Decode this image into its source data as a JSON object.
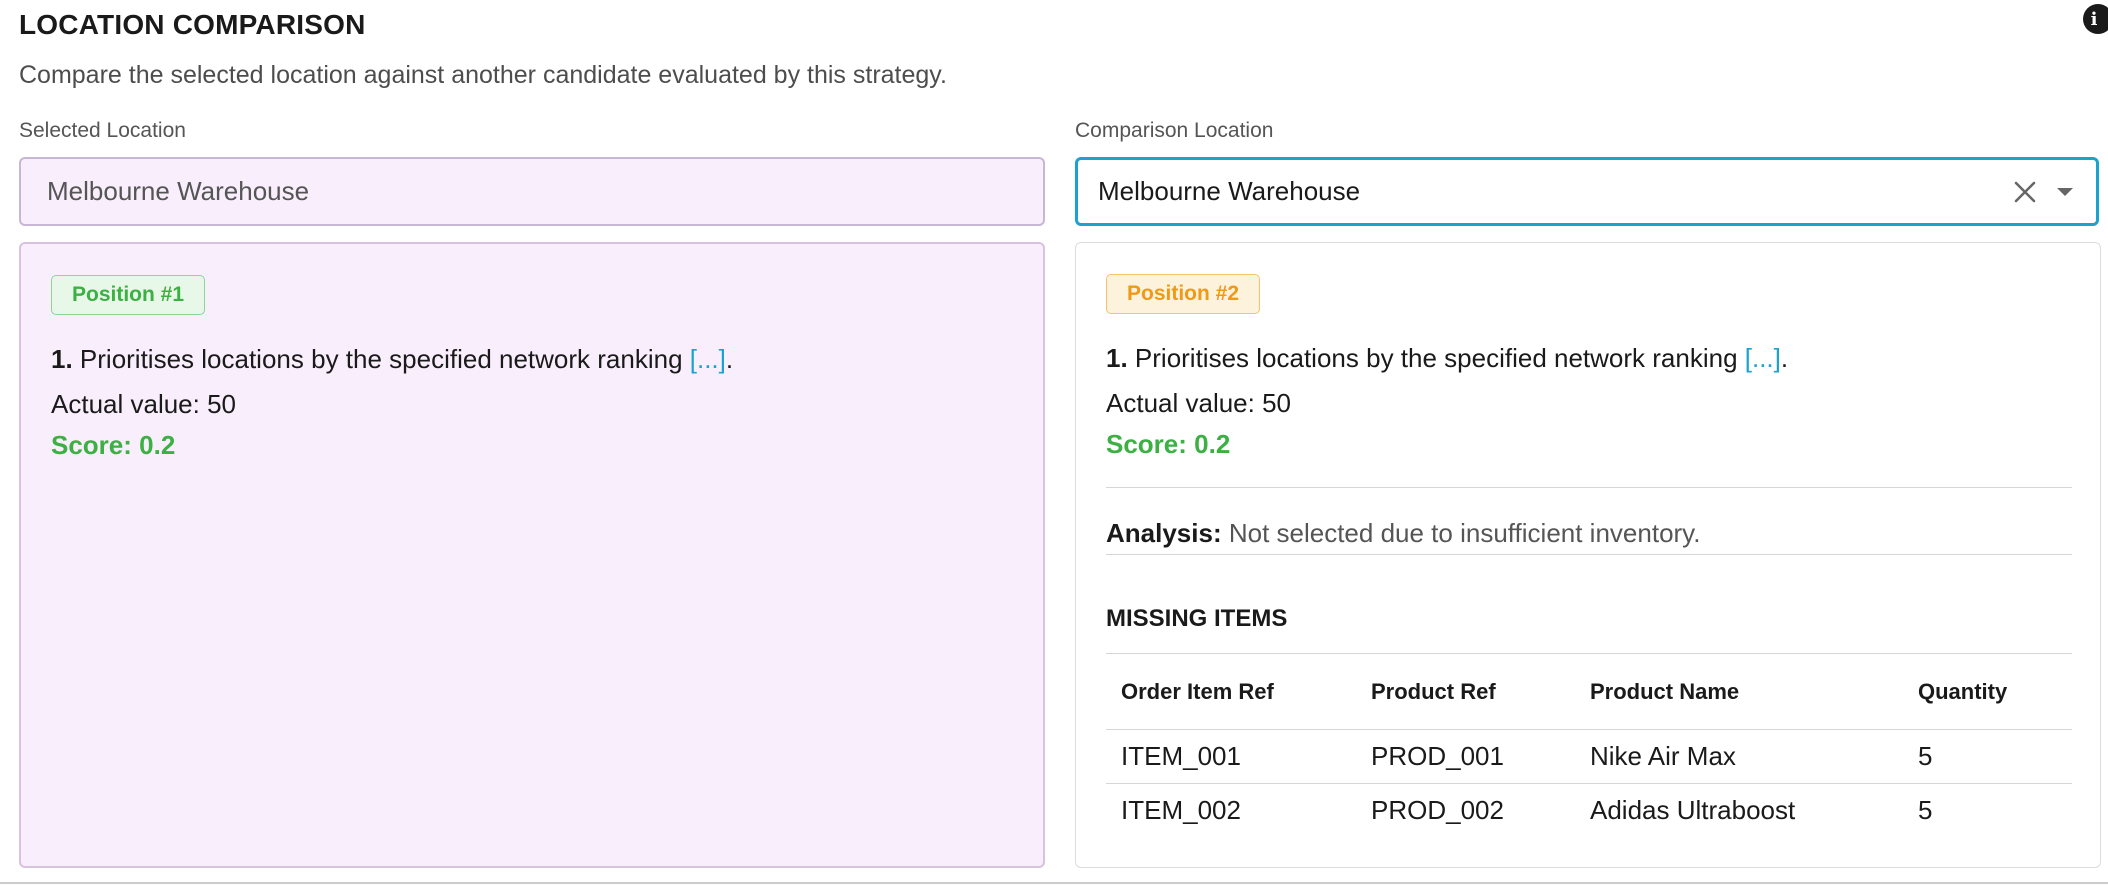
{
  "header": {
    "title": "LOCATION COMPARISON",
    "subtitle": "Compare the selected location against another candidate evaluated by this strategy.",
    "info_icon": "info-icon"
  },
  "selected": {
    "label": "Selected Location",
    "value": "Melbourne Warehouse",
    "panel": {
      "badge": "Position #1",
      "rule_number": "1.",
      "rule_text": " Prioritises locations by the specified network ranking ",
      "rule_link": "[...]",
      "rule_end": ".",
      "actual_value": "Actual value: 50",
      "score": "Score: 0.2"
    }
  },
  "comparison": {
    "label": "Comparison Location",
    "value": "Melbourne Warehouse",
    "clear_icon": "close-icon",
    "dropdown_icon": "chevron-down-icon",
    "panel": {
      "badge": "Position #2",
      "rule_number": "1.",
      "rule_text": " Prioritises locations by the specified network ranking ",
      "rule_link": "[...]",
      "rule_end": ".",
      "actual_value": "Actual value: 50",
      "score": "Score: 0.2",
      "analysis_label": "Analysis:",
      "analysis_text": " Not selected due to insufficient inventory.",
      "missing_title": "MISSING ITEMS",
      "columns": [
        "Order Item Ref",
        "Product Ref",
        "Product Name",
        "Quantity"
      ],
      "rows": [
        [
          "ITEM_001",
          "PROD_001",
          "Nike Air Max",
          "5"
        ],
        [
          "ITEM_002",
          "PROD_002",
          "Adidas Ultraboost",
          "5"
        ]
      ]
    }
  },
  "colors": {
    "accent": "#1ba3cf",
    "score_green": "#3cb043",
    "badge_orange": "#ee9a16",
    "selected_bg": "#f9eefc"
  }
}
